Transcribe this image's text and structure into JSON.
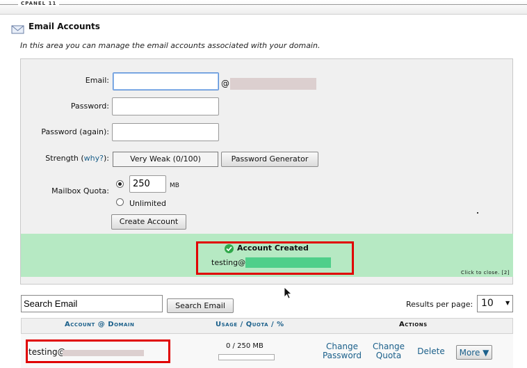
{
  "brand": "CPANEL 11",
  "page": {
    "title": "Email Accounts",
    "intro": "In this area you can manage the email accounts associated with your domain."
  },
  "form": {
    "email_label": "Email:",
    "at_sign": "@",
    "email_value": "",
    "password_label": "Password:",
    "password_again_label": "Password (again):",
    "strength_label_prefix": "Strength (",
    "strength_link": "why?",
    "strength_label_suffix": "):",
    "strength_value": "Very Weak (0/100)",
    "password_generator_label": "Password Generator",
    "mailbox_quota_label": "Mailbox Quota:",
    "quota_value": "250",
    "quota_unit": "MB",
    "unlimited_label": "Unlimited",
    "create_account_label": "Create Account"
  },
  "notice": {
    "title": "Account Created",
    "account_prefix": "testing@",
    "close_text": "Click to close. [2]"
  },
  "search": {
    "placeholder": "Search Email",
    "button_label": "Search Email",
    "results_per_page_label": "Results per page:",
    "results_per_page_value": "10"
  },
  "table": {
    "headers": {
      "account_prefix": "Account",
      "account_at": " @ ",
      "account_domain": "Domain",
      "usage": "Usage",
      "slash1": " / ",
      "quota": "Quota",
      "slash2": " / ",
      "percent": "%",
      "actions": "Actions"
    },
    "rows": [
      {
        "account_prefix": "testing@",
        "usage": "0 / 250 MB",
        "usage_fraction": 0,
        "change_password_line1": "Change",
        "change_password_line2": "Password",
        "change_quota_line1": "Change",
        "change_quota_line2": "Quota",
        "delete_label": "Delete",
        "more_label": "More ▼"
      }
    ]
  },
  "colors": {
    "success_background": "#b6e9c3",
    "highlight_border": "#e00000",
    "link": "#1a5f8a"
  }
}
